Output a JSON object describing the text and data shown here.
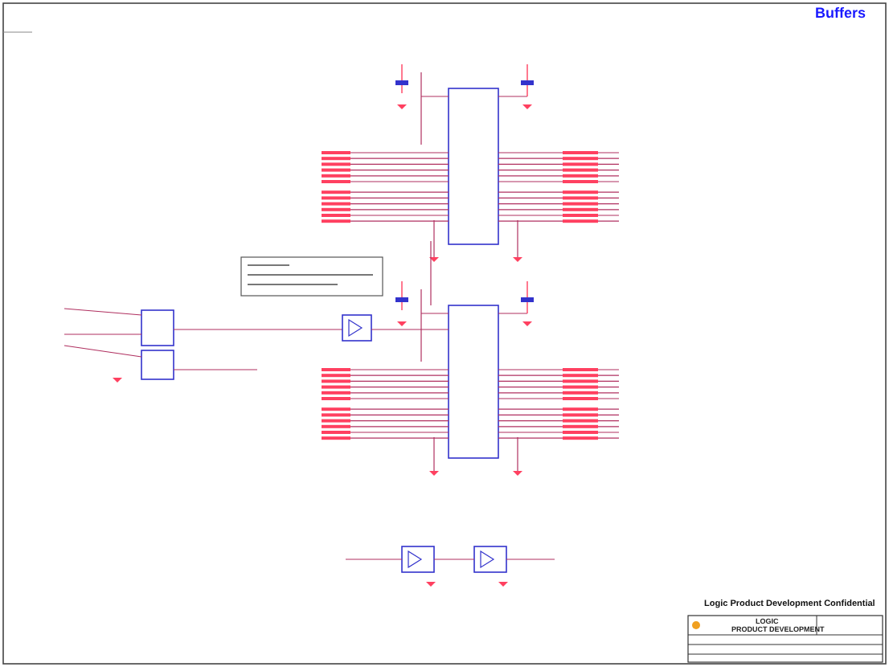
{
  "sheet": {
    "title": "Buffers",
    "confidential": "Logic Product Development Confidential"
  },
  "title_block": {
    "company": "LOGIC",
    "department": "PRODUCT DEVELOPMENT"
  }
}
